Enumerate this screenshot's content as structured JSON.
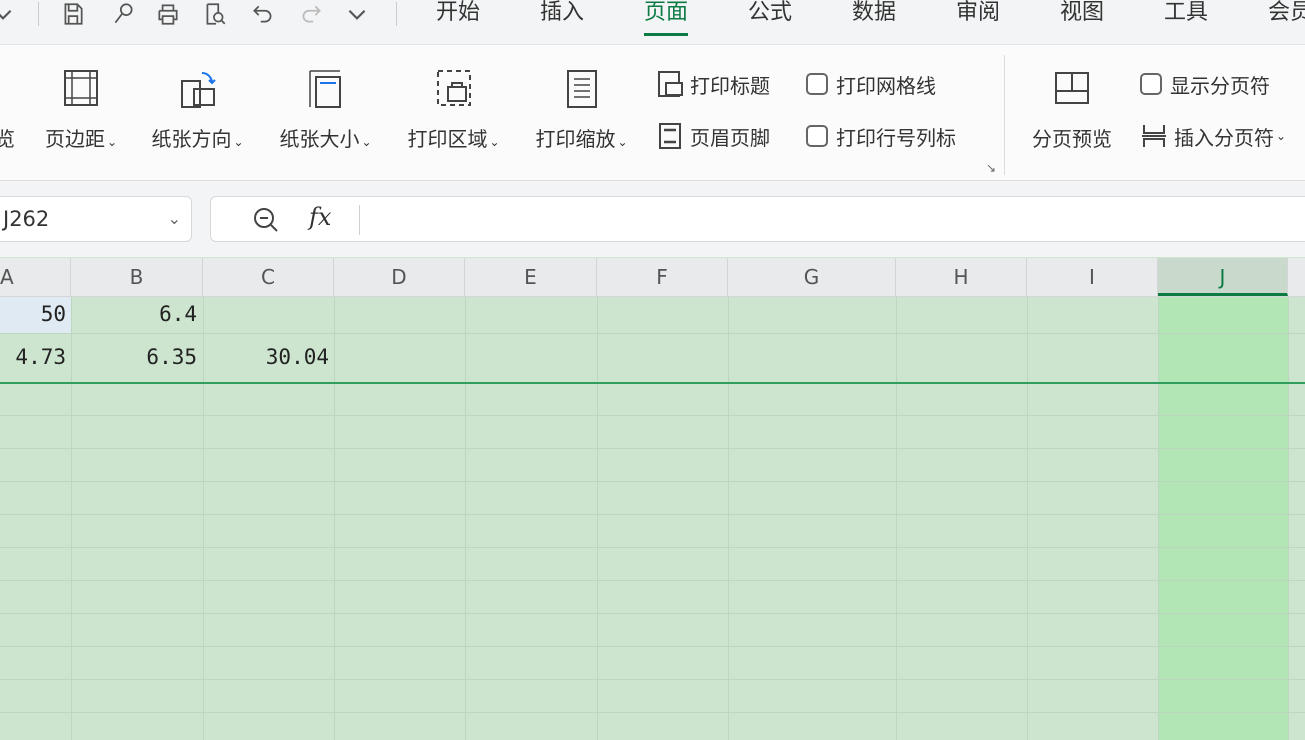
{
  "quick_access": {
    "icons": [
      "chevron-down-icon",
      "save-icon",
      "format-painter-icon",
      "print-icon",
      "print-preview-icon",
      "undo-icon",
      "redo-icon",
      "more-icon"
    ]
  },
  "tabs": [
    {
      "label": "开始",
      "active": false
    },
    {
      "label": "插入",
      "active": false
    },
    {
      "label": "页面",
      "active": true
    },
    {
      "label": "公式",
      "active": false
    },
    {
      "label": "数据",
      "active": false
    },
    {
      "label": "审阅",
      "active": false
    },
    {
      "label": "视图",
      "active": false
    },
    {
      "label": "工具",
      "active": false
    },
    {
      "label": "会员",
      "active": false
    }
  ],
  "ribbon": {
    "cut_label": "览",
    "margins": "页边距",
    "orientation": "纸张方向",
    "size": "纸张大小",
    "print_area": "打印区域",
    "print_scale": "打印缩放",
    "print_titles": "打印标题",
    "header_footer": "页眉页脚",
    "print_gridlines": "打印网格线",
    "print_headings": "打印行号列标",
    "page_break_preview": "分页预览",
    "show_page_breaks": "显示分页符",
    "insert_page_break": "插入分页符",
    "dropdown_glyph": "⌄"
  },
  "formula_bar": {
    "name_box": "J262",
    "fx": "fx",
    "formula": ""
  },
  "columns": [
    "A",
    "B",
    "C",
    "D",
    "E",
    "F",
    "G",
    "H",
    "I",
    "J"
  ],
  "selected_column": "J",
  "cells": [
    {
      "col": "A",
      "row": 1,
      "value": "50"
    },
    {
      "col": "B",
      "row": 1,
      "value": "6.4"
    },
    {
      "col": "A",
      "row": 2,
      "value": "4.73"
    },
    {
      "col": "B",
      "row": 2,
      "value": "6.35"
    },
    {
      "col": "C",
      "row": 2,
      "value": "30.04"
    }
  ],
  "colors": {
    "accent": "#0c7a43",
    "grid_fill": "#cde5cf",
    "selected_column_fill": "#b2e6b4",
    "page_break_line": "#2f9e5e"
  }
}
